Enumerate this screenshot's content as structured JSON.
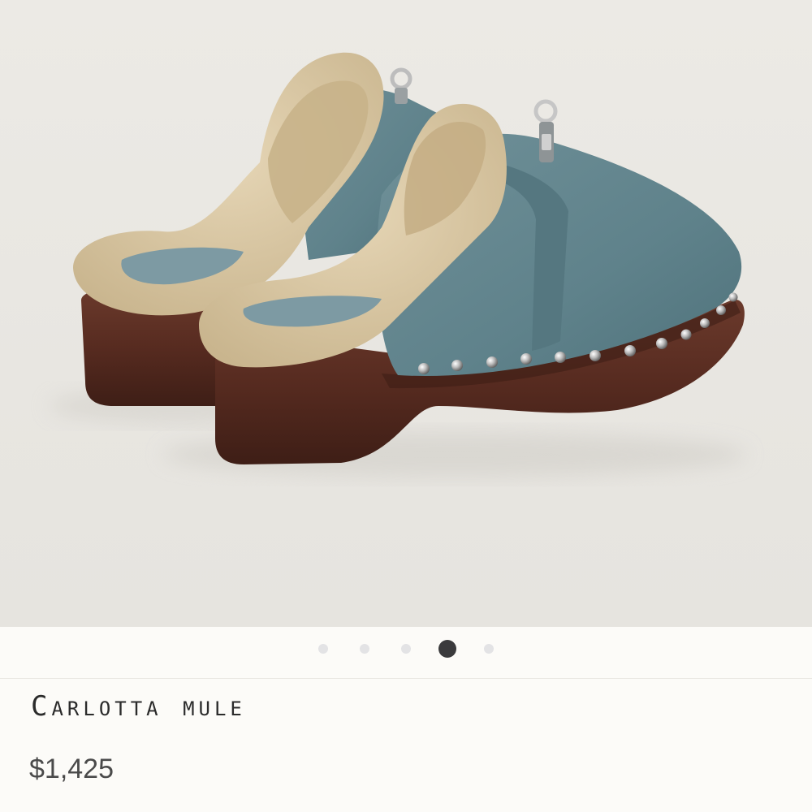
{
  "product": {
    "name": "Carlotta mule",
    "price": "$1,425",
    "image_alt": "Blue suede clog mules with shearling lining and studded wooden sole"
  },
  "carousel": {
    "total": 5,
    "active_index": 3
  },
  "colors": {
    "suede": "#6b8b93",
    "shearling": "#d9c8a6",
    "wood": "#5a2d22",
    "active_dot": "#3a3a3c",
    "inactive_dot": "#e3e3e5"
  }
}
